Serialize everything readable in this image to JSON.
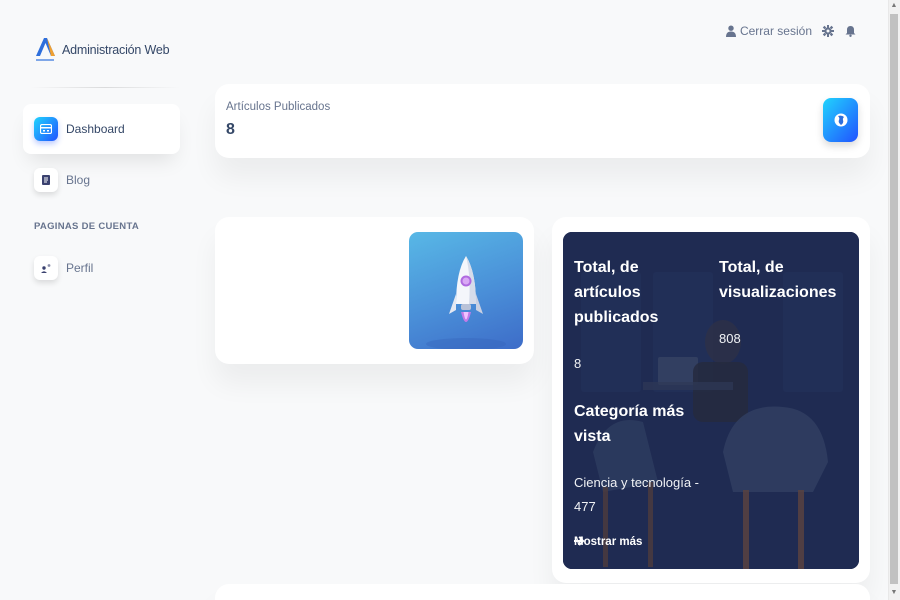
{
  "brand": {
    "title": "Administración Web",
    "logo_icon": "a-logo-icon"
  },
  "sidebar": {
    "items": [
      {
        "label": "Dashboard",
        "icon": "dashboard-icon",
        "active": true
      },
      {
        "label": "Blog",
        "icon": "document-icon",
        "active": false
      },
      {
        "label": "Perfil",
        "icon": "user-icon",
        "active": false
      }
    ],
    "section_label": "PAGINAS DE CUENTA"
  },
  "topbar": {
    "logout_label": "Cerrar sesión",
    "icons": [
      "user-icon",
      "gear-icon",
      "bell-icon"
    ]
  },
  "stats": {
    "label": "Artículos Publicados",
    "value": "8",
    "icon": "globe-icon"
  },
  "info_card": {
    "total_articles_title": "Total, de artículos publicados",
    "total_articles_value": "8",
    "total_views_title": "Total, de visualizaciones",
    "total_views_value": "808",
    "top_category_title": "Categoría más vista",
    "top_category_value": "Ciencia y tecnología - 477",
    "more_label": "Mostrar más"
  },
  "colors": {
    "accent_gradient_start": "#2152ff",
    "accent_gradient_end": "#21d4fd",
    "text_primary": "#344767",
    "text_secondary": "#67748e"
  }
}
